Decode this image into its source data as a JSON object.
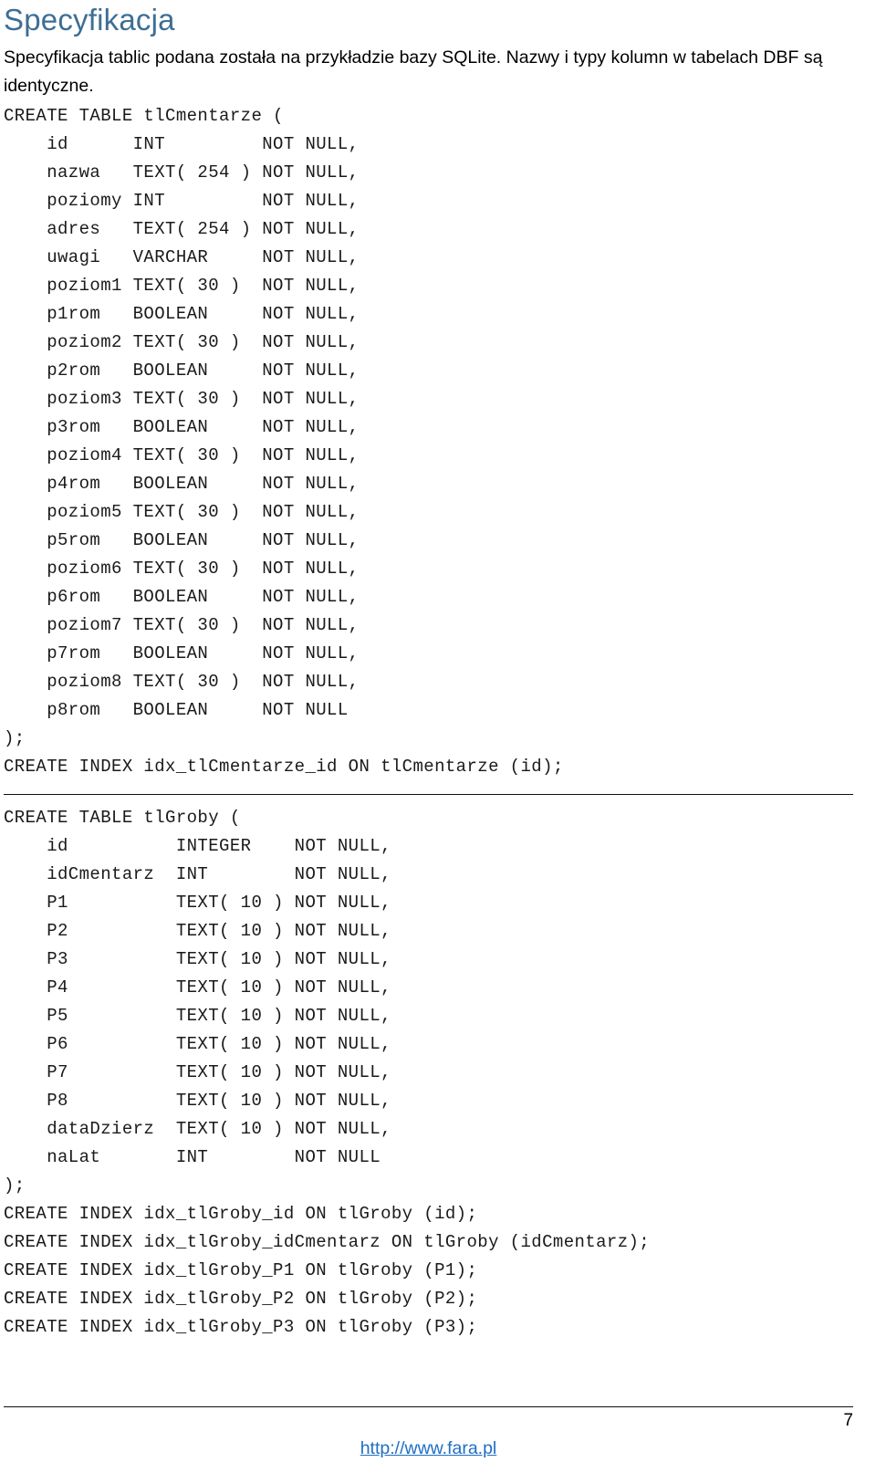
{
  "document": {
    "title": "Specyfikacja",
    "title_color": "#3E6E94",
    "intro_paragraph": "Specyfikacja tablic podana została na przykładzie bazy SQLite. Nazwy i typy kolumn w tabelach DBF są identyczne."
  },
  "code_block_1": {
    "lines": [
      "CREATE TABLE tlCmentarze (",
      "    id      INT         NOT NULL,",
      "    nazwa   TEXT( 254 ) NOT NULL,",
      "    poziomy INT         NOT NULL,",
      "    adres   TEXT( 254 ) NOT NULL,",
      "    uwagi   VARCHAR     NOT NULL,",
      "    poziom1 TEXT( 30 )  NOT NULL,",
      "    p1rom   BOOLEAN     NOT NULL,",
      "    poziom2 TEXT( 30 )  NOT NULL,",
      "    p2rom   BOOLEAN     NOT NULL,",
      "    poziom3 TEXT( 30 )  NOT NULL,",
      "    p3rom   BOOLEAN     NOT NULL,",
      "    poziom4 TEXT( 30 )  NOT NULL,",
      "    p4rom   BOOLEAN     NOT NULL,",
      "    poziom5 TEXT( 30 )  NOT NULL,",
      "    p5rom   BOOLEAN     NOT NULL,",
      "    poziom6 TEXT( 30 )  NOT NULL,",
      "    p6rom   BOOLEAN     NOT NULL,",
      "    poziom7 TEXT( 30 )  NOT NULL,",
      "    p7rom   BOOLEAN     NOT NULL,",
      "    poziom8 TEXT( 30 )  NOT NULL,",
      "    p8rom   BOOLEAN     NOT NULL",
      ");",
      "CREATE INDEX idx_tlCmentarze_id ON tlCmentarze (id);"
    ]
  },
  "code_block_2": {
    "lines": [
      "CREATE TABLE tlGroby (",
      "    id          INTEGER    NOT NULL,",
      "    idCmentarz  INT        NOT NULL,",
      "    P1          TEXT( 10 ) NOT NULL,",
      "    P2          TEXT( 10 ) NOT NULL,",
      "    P3          TEXT( 10 ) NOT NULL,",
      "    P4          TEXT( 10 ) NOT NULL,",
      "    P5          TEXT( 10 ) NOT NULL,",
      "    P6          TEXT( 10 ) NOT NULL,",
      "    P7          TEXT( 10 ) NOT NULL,",
      "    P8          TEXT( 10 ) NOT NULL,",
      "    dataDzierz  TEXT( 10 ) NOT NULL,",
      "    naLat       INT        NOT NULL",
      ");",
      "CREATE INDEX idx_tlGroby_id ON tlGroby (id);",
      "CREATE INDEX idx_tlGroby_idCmentarz ON tlGroby (idCmentarz);",
      "CREATE INDEX idx_tlGroby_P1 ON tlGroby (P1);",
      "CREATE INDEX idx_tlGroby_P2 ON tlGroby (P2);",
      "CREATE INDEX idx_tlGroby_P3 ON tlGroby (P3);"
    ]
  },
  "footer": {
    "page_number": "7",
    "link_text": "http://www.fara.pl",
    "link_color": "#1F6FC4"
  }
}
